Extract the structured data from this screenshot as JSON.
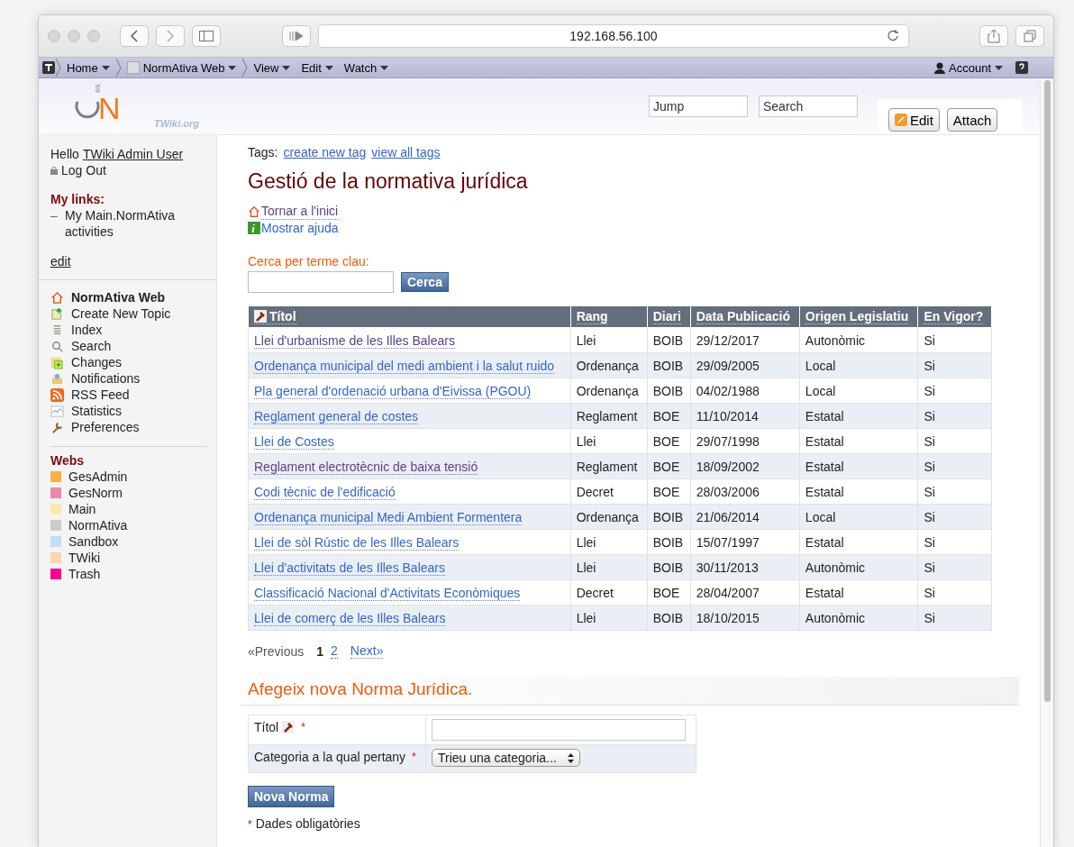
{
  "browser": {
    "url": "192.168.56.100"
  },
  "twiki_bar": {
    "crumbs": [
      {
        "label": "Home",
        "kind": "plain"
      },
      {
        "label": "NormAtiva Web",
        "kind": "web"
      }
    ],
    "menus": [
      "View",
      "Edit",
      "Watch"
    ],
    "account": "Account"
  },
  "header": {
    "logo": {
      "mark": "es",
      "letter": "N",
      "caption": "TWiki.org"
    },
    "jump": {
      "placeholder": "Jump"
    },
    "search": {
      "placeholder": "Search"
    },
    "buttons": [
      {
        "label": "Edit",
        "kind": "edit"
      },
      {
        "label": "Attach",
        "kind": "plain"
      }
    ]
  },
  "sidebar": {
    "greeting": "Hello",
    "user": "TWiki Admin User",
    "logout": "Log Out",
    "my_links_title": "My links:",
    "my_links": [
      {
        "bullet": "–",
        "label": "My Main.NormAtiva activities"
      }
    ],
    "edit": "edit",
    "web_items": [
      {
        "label": "NormAtiva Web",
        "kind": "home",
        "bold": true
      },
      {
        "label": "Create New Topic",
        "kind": "new",
        "bold": false
      },
      {
        "label": "Index",
        "kind": "index",
        "bold": false
      },
      {
        "label": "Search",
        "kind": "search",
        "bold": false
      },
      {
        "label": "Changes",
        "kind": "changes",
        "bold": false
      },
      {
        "label": "Notifications",
        "kind": "notify",
        "bold": false
      },
      {
        "label": "RSS Feed",
        "kind": "rss",
        "bold": false
      },
      {
        "label": "Statistics",
        "kind": "stats",
        "bold": false
      },
      {
        "label": "Preferences",
        "kind": "prefs",
        "bold": false
      }
    ],
    "webs_title": "Webs",
    "webs": [
      {
        "label": "GesAdmin",
        "color": "#fbb040"
      },
      {
        "label": "GesNorm",
        "color": "#ee86a8"
      },
      {
        "label": "Main",
        "color": "#fdeaa8"
      },
      {
        "label": "NormAtiva",
        "color": "#cccccc"
      },
      {
        "label": "Sandbox",
        "color": "#c3dcfb"
      },
      {
        "label": "TWiki",
        "color": "#fdd6a8"
      },
      {
        "label": "Trash",
        "color": "#ff0090"
      }
    ]
  },
  "content": {
    "tags_label": "Tags:",
    "tag_links": [
      "create new tag",
      "view all tags"
    ],
    "title": "Gestió de la normativa jurídica",
    "links": [
      {
        "label": "Tornar a l'inici",
        "kind": "home",
        "visited": true
      },
      {
        "label": "Mostrar ajuda",
        "kind": "info",
        "visited": false
      }
    ],
    "search_label": "Cerca per terme clau:",
    "search_button": "Cerca",
    "table": {
      "columns": [
        "Títol",
        "Rang",
        "Diari",
        "Data Publicació",
        "Origen Legislatiu",
        "En Vigor?"
      ],
      "rows": [
        {
          "visited": true,
          "cells": [
            "Llei d'urbanisme de les Illes Balears",
            "Llei",
            "BOIB",
            "29/12/2017",
            "Autonòmic",
            "Si"
          ]
        },
        {
          "visited": false,
          "cells": [
            "Ordenança municipal del medi ambient i la salut ruido",
            "Ordenança",
            "BOIB",
            "29/09/2005",
            "Local",
            "Si"
          ]
        },
        {
          "visited": false,
          "cells": [
            "Pla general d'ordenació urbana d'Eivissa (PGOU)",
            "Ordenança",
            "BOIB",
            "04/02/1988",
            "Local",
            "Si"
          ]
        },
        {
          "visited": false,
          "cells": [
            "Reglament general de costes",
            "Reglament",
            "BOE",
            "11/10/2014",
            "Estatal",
            "Si"
          ]
        },
        {
          "visited": false,
          "cells": [
            "Llei de Costes",
            "Llei",
            "BOE",
            "29/07/1998",
            "Estatal",
            "Si"
          ]
        },
        {
          "visited": true,
          "cells": [
            "Reglament electrotècnic de baixa tensió",
            "Reglament",
            "BOE",
            "18/09/2002",
            "Estatal",
            "Si"
          ]
        },
        {
          "visited": false,
          "cells": [
            "Codi tècnic de l'edificació",
            "Decret",
            "BOE",
            "28/03/2006",
            "Estatal",
            "Si"
          ]
        },
        {
          "visited": false,
          "cells": [
            "Ordenança municipal Medi Ambient Formentera",
            "Ordenança",
            "BOIB",
            "21/06/2014",
            "Local",
            "Si"
          ]
        },
        {
          "visited": false,
          "cells": [
            "Llei de sòl Rústic de les Illes Balears",
            "Llei",
            "BOIB",
            "15/07/1997",
            "Estatal",
            "Si"
          ]
        },
        {
          "visited": false,
          "cells": [
            "Llei d'activitats de les Illes Balears",
            "Llei",
            "BOIB",
            "30/11/2013",
            "Autonòmic",
            "Si"
          ]
        },
        {
          "visited": false,
          "cells": [
            "Classificació Nacional d'Activitats Econòmiques",
            "Decret",
            "BOE",
            "28/04/2007",
            "Estatal",
            "Si"
          ]
        },
        {
          "visited": false,
          "cells": [
            "Llei de comerç de les Illes Balears",
            "Llei",
            "BOIB",
            "18/10/2015",
            "Autonòmic",
            "Si"
          ]
        }
      ]
    },
    "pagination": {
      "previous": "«Previous",
      "pages": [
        {
          "label": "1",
          "selected": true
        },
        {
          "label": "2",
          "selected": false
        }
      ],
      "next": "Next»"
    },
    "form": {
      "heading": "Afegeix nova Norma Jurídica.",
      "fields": [
        {
          "label": "Títol",
          "icon": true,
          "mark": "*",
          "kind": "text"
        },
        {
          "label": "Categoria a la qual pertany",
          "icon": false,
          "mark": "*",
          "kind": "select",
          "value": "Trieu una categoria..."
        }
      ],
      "submit": "Nova Norma",
      "note": {
        "mark": "*",
        "text": "Dades obligatòries"
      }
    }
  }
}
